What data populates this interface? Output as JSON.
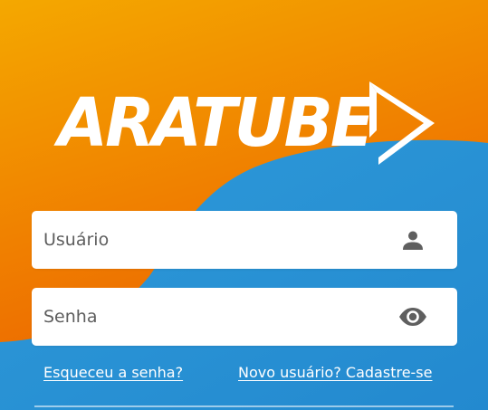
{
  "app": {
    "logo_text": "ARATUBE"
  },
  "login": {
    "username_placeholder": "Usuário",
    "password_placeholder": "Senha",
    "forgot_password_link": "Esqueceu a senha?",
    "signup_link": "Novo usuário? Cadastre-se"
  },
  "icons": {
    "username": "person-icon",
    "password": "eye-icon",
    "logo_mark": "play-icon"
  },
  "colors": {
    "orange_top": "#f4a800",
    "orange_mid": "#f07f00",
    "orange_deep": "#ea5f00",
    "blue": "#2a93d5",
    "white": "#ffffff",
    "icon_gray": "#5f5f5f"
  }
}
